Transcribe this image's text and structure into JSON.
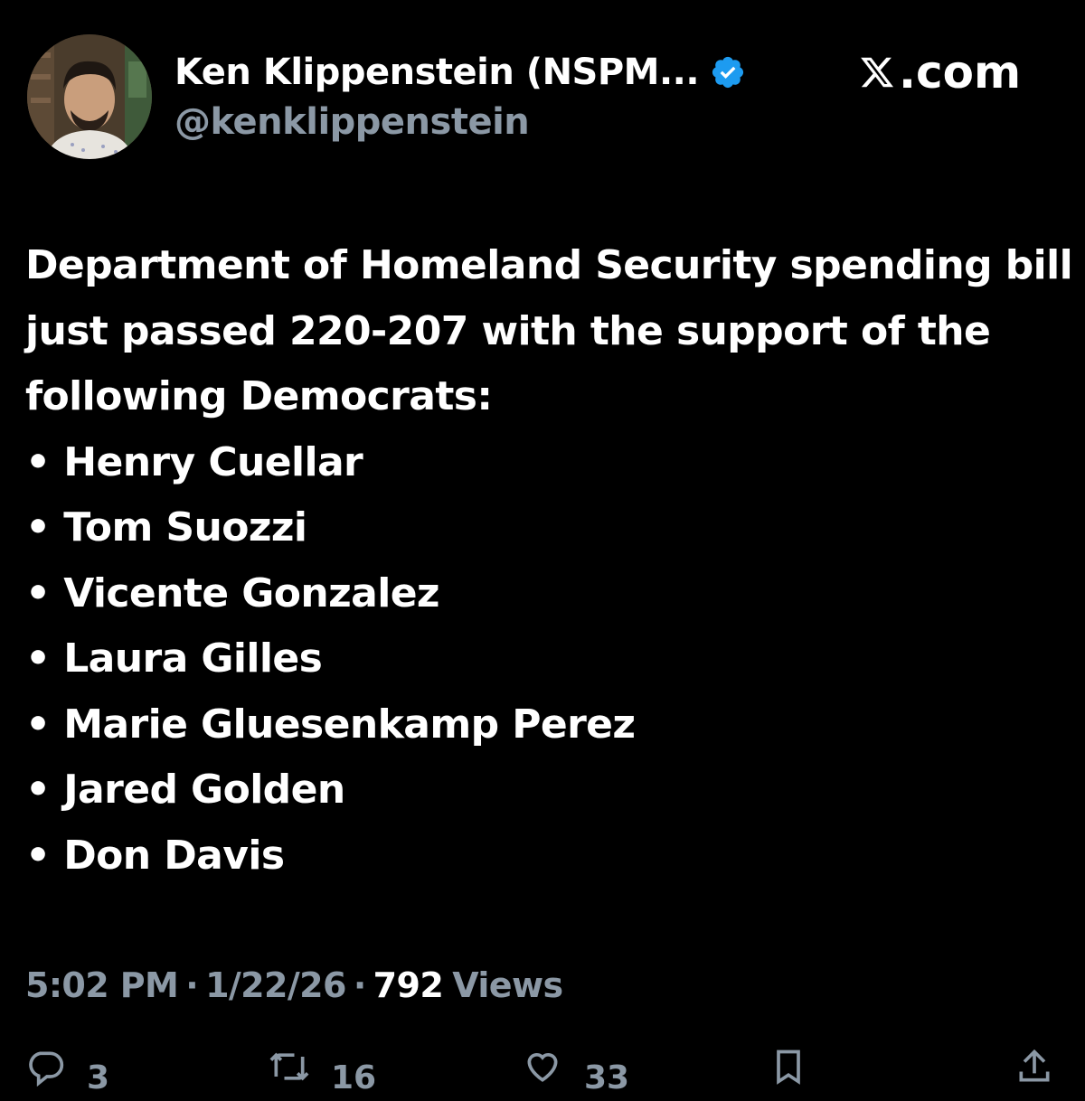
{
  "author": {
    "display_name": "Ken Klippenstein (NSPM...",
    "handle": "@kenklippenstein",
    "verified": true,
    "verified_color": "#1d9bf0"
  },
  "brand": {
    "domain": ".com"
  },
  "tweet": {
    "intro": "Department of Homeland Security spending bill just passed 220-207 with the support of the following Democrats:",
    "members": [
      "• Henry Cuellar",
      "• Tom Suozzi",
      "• Vicente Gonzalez",
      "• Laura Gilles",
      "• Marie Gluesenkamp Perez",
      "• Jared Golden",
      "• Don Davis"
    ]
  },
  "meta": {
    "time": "5:02 PM",
    "separator": "·",
    "date": "1/22/26",
    "views_count": "792",
    "views_label": "Views"
  },
  "actions": {
    "replies": "3",
    "reposts": "16",
    "likes": "33"
  },
  "colors": {
    "background": "#000000",
    "text": "#ffffff",
    "muted": "#8b98a5"
  }
}
